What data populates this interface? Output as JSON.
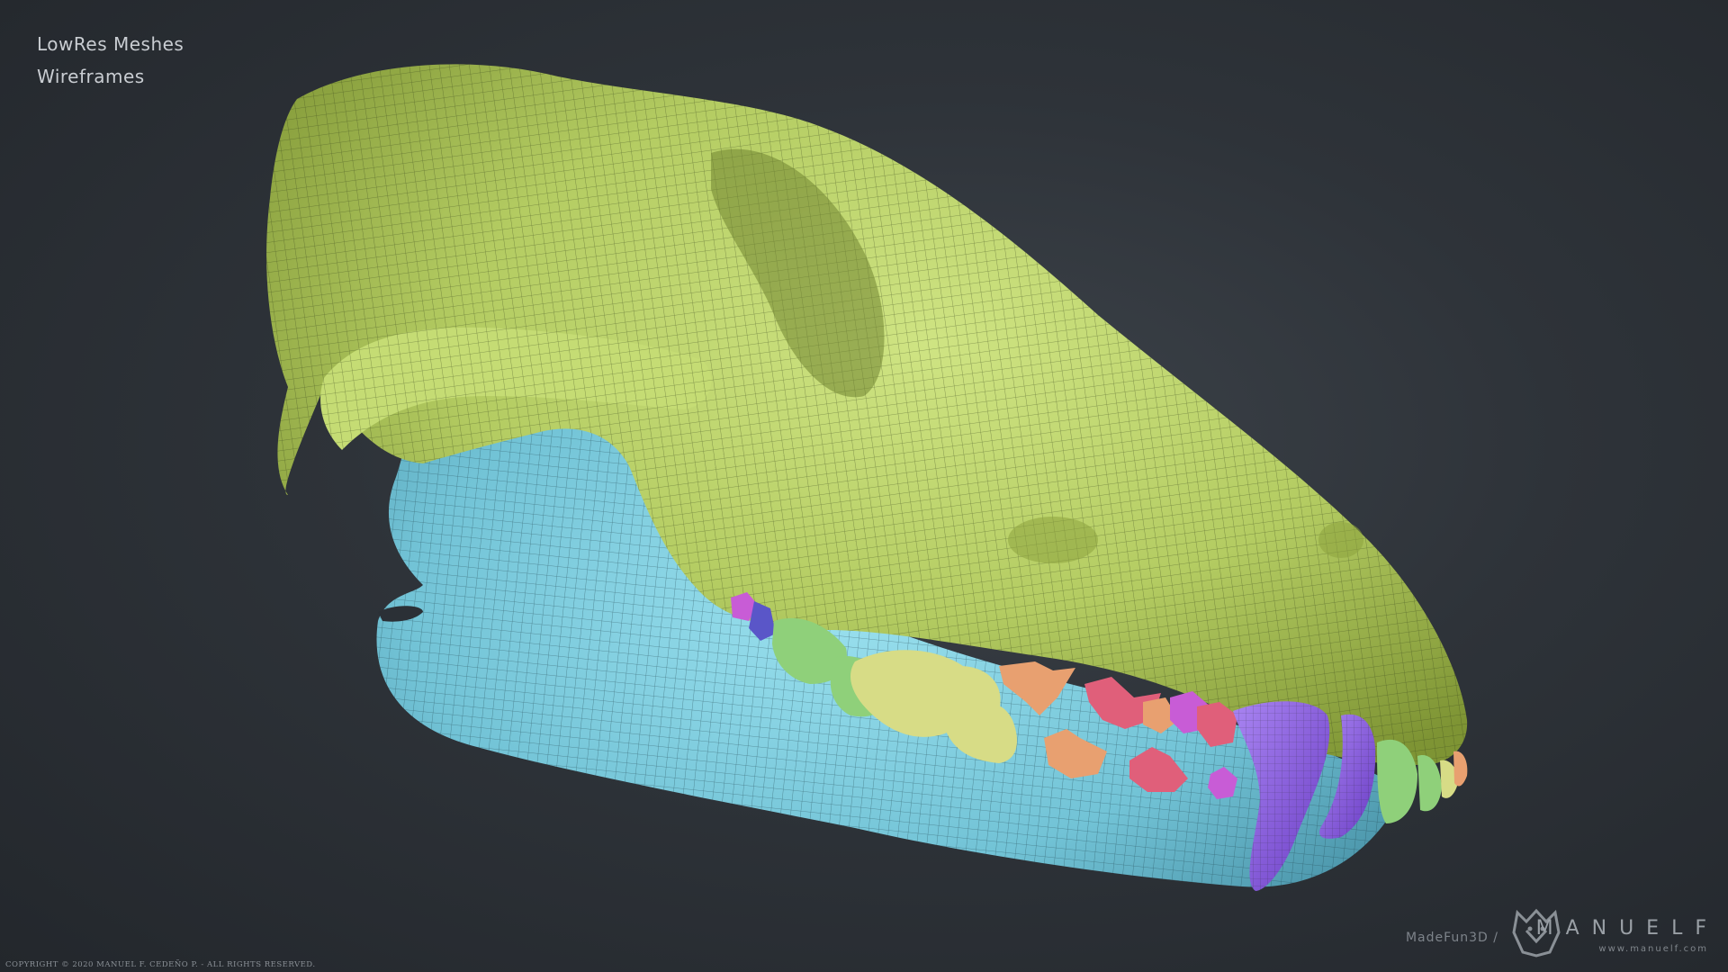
{
  "overlay": {
    "line1": "LowRes Meshes",
    "line2": "Wireframes"
  },
  "footer": {
    "copyright": "COPYRIGHT © 2020 MANUEL F. CEDEÑO P. - ALL RIGHTS RESERVED.",
    "brand_prefix": "MadeFun3D /",
    "brand_name": "MANUELF",
    "brand_url": "www.manuelf.com"
  },
  "colors": {
    "background": "#2e3339",
    "skull": "#b9d26a",
    "mandible": "#7fcfe0",
    "canine": "#8d5fe0",
    "premolar_orange": "#e8a070",
    "premolar_pink": "#e05f7a",
    "molar_green": "#8fd07a",
    "molar_yellow": "#d7dc86",
    "incisor_magenta": "#c85cd6"
  },
  "subject": "wolf-skull-lowres-wireframe-render"
}
